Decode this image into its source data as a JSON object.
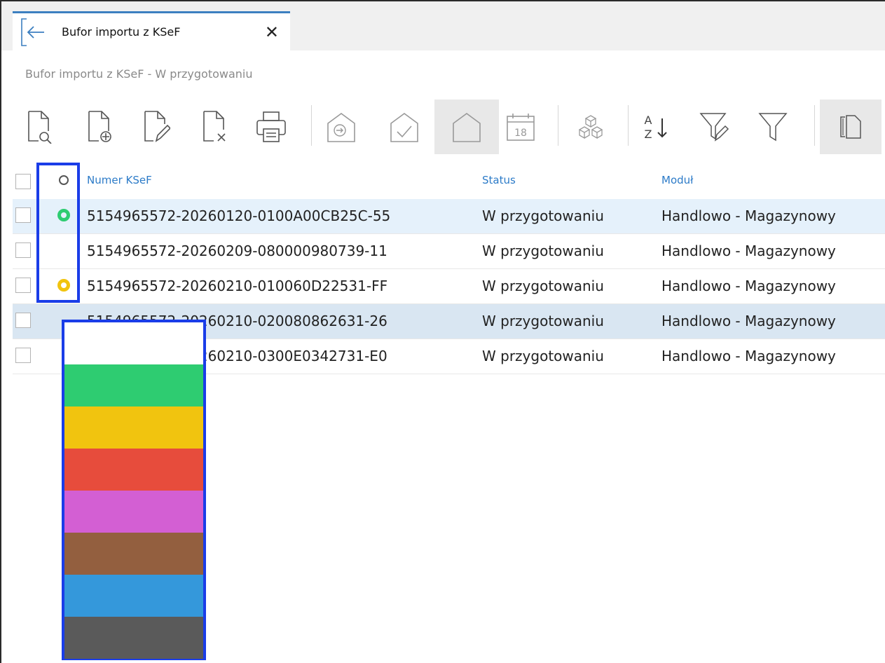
{
  "tab": {
    "title": "Bufor importu z KSeF",
    "close_glyph": "✕"
  },
  "breadcrumb": "Bufor importu z KSeF - W przygotowaniu",
  "toolbar": {
    "calendar_day": "18",
    "sort_a": "A",
    "sort_z": "Z",
    "buttons": [
      "preview-doc-icon",
      "add-doc-icon",
      "edit-doc-icon",
      "delete-doc-icon",
      "print-icon",
      "import-house-icon",
      "confirm-house-icon",
      "house-icon",
      "calendar-icon",
      "cubes-icon",
      "sort-az-icon",
      "edit-filter-icon",
      "filter-icon",
      "copy-pages-icon"
    ]
  },
  "grid": {
    "headers": {
      "number": "Numer KSeF",
      "status": "Status",
      "module": "Moduł"
    },
    "rows": [
      {
        "number": "5154965572-20260120-0100A00CB25C-55",
        "status": "W przygotowaniu",
        "module": "Handlowo - Magazynowy",
        "marker": "#2ecc71"
      },
      {
        "number": "5154965572-20260209-080000980739-11",
        "status": "W przygotowaniu",
        "module": "Handlowo - Magazynowy",
        "marker": ""
      },
      {
        "number": "5154965572-20260210-010060D22531-FF",
        "status": "W przygotowaniu",
        "module": "Handlowo - Magazynowy",
        "marker": "#f1c40f"
      },
      {
        "number": "5154965572-20260210-020080862631-26",
        "status": "W przygotowaniu",
        "module": "Handlowo - Magazynowy",
        "marker": ""
      },
      {
        "number": "5154965572-20260210-0300E0342731-E0",
        "status": "W przygotowaniu",
        "module": "Handlowo - Magazynowy",
        "marker": ""
      }
    ]
  },
  "palette_colors": [
    "#ffffff",
    "#2ecc71",
    "#f1c40f",
    "#e74c3c",
    "#d35fd3",
    "#935f3f",
    "#3498db",
    "#5a5a5a"
  ],
  "colors": {
    "accent": "#2c7bc8",
    "highlight_border": "#1a3de8",
    "selected_row": "#e5f1fb",
    "hover_row": "#d9e6f2"
  }
}
